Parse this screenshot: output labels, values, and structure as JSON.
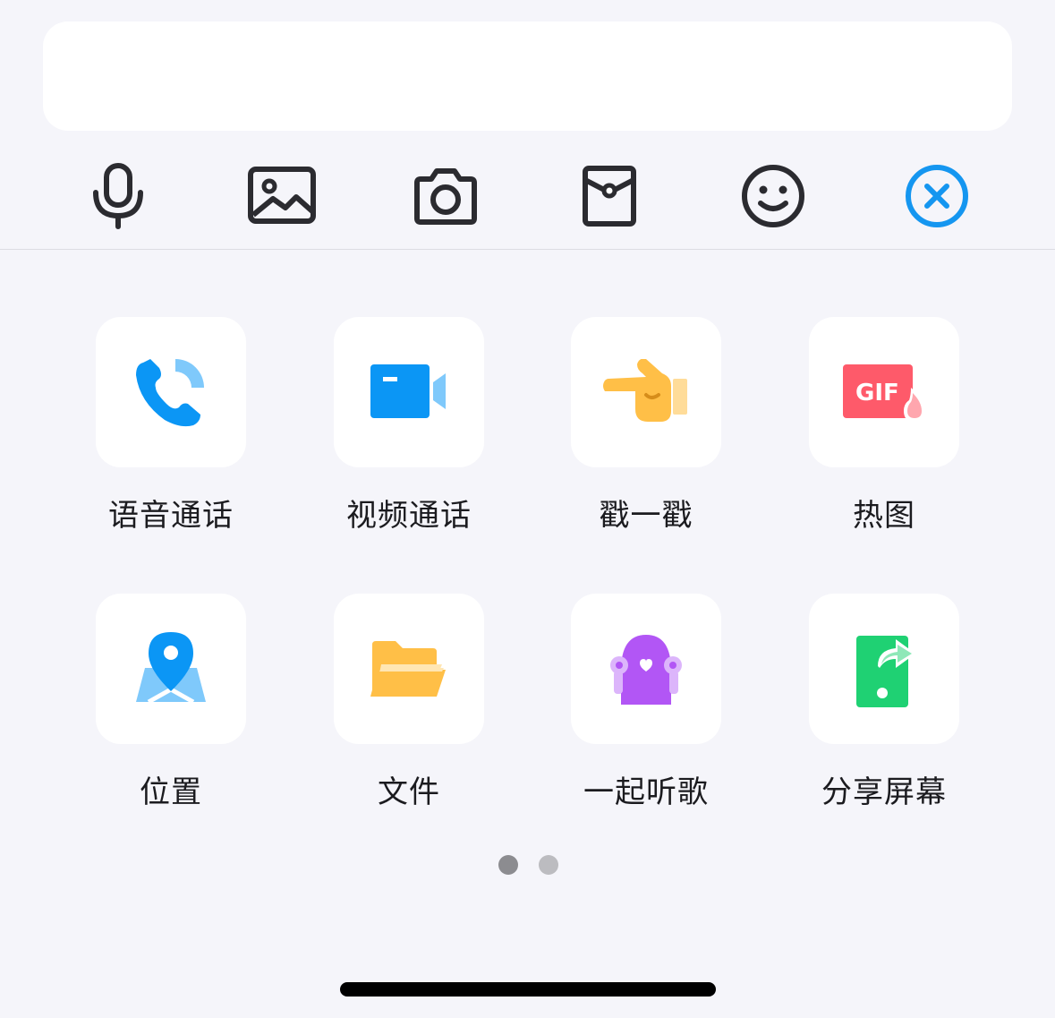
{
  "input": {
    "value": ""
  },
  "toolbar": {
    "items": [
      {
        "icon": "microphone-icon"
      },
      {
        "icon": "image-icon"
      },
      {
        "icon": "camera-icon"
      },
      {
        "icon": "red-packet-icon"
      },
      {
        "icon": "emoji-icon"
      },
      {
        "icon": "close-circle-icon"
      }
    ],
    "icon_color": "#2b2b30",
    "active_color": "#1596f0"
  },
  "panel": {
    "items": [
      {
        "label": "语音通话",
        "icon": "voice-call-icon"
      },
      {
        "label": "视频通话",
        "icon": "video-call-icon"
      },
      {
        "label": "戳一戳",
        "icon": "poke-hand-icon"
      },
      {
        "label": "热图",
        "icon": "hot-gif-icon"
      },
      {
        "label": "位置",
        "icon": "location-map-icon"
      },
      {
        "label": "文件",
        "icon": "folder-icon"
      },
      {
        "label": "一起听歌",
        "icon": "listen-together-icon"
      },
      {
        "label": "分享屏幕",
        "icon": "share-screen-icon"
      }
    ]
  },
  "pagination": {
    "current": 1,
    "total": 2
  },
  "colors": {
    "blue": "#0b96f5",
    "light_blue": "#7fc9fb",
    "yellow": "#ffbf47",
    "red": "#fe5a6a",
    "purple": "#b256f5",
    "green": "#1fd173"
  }
}
